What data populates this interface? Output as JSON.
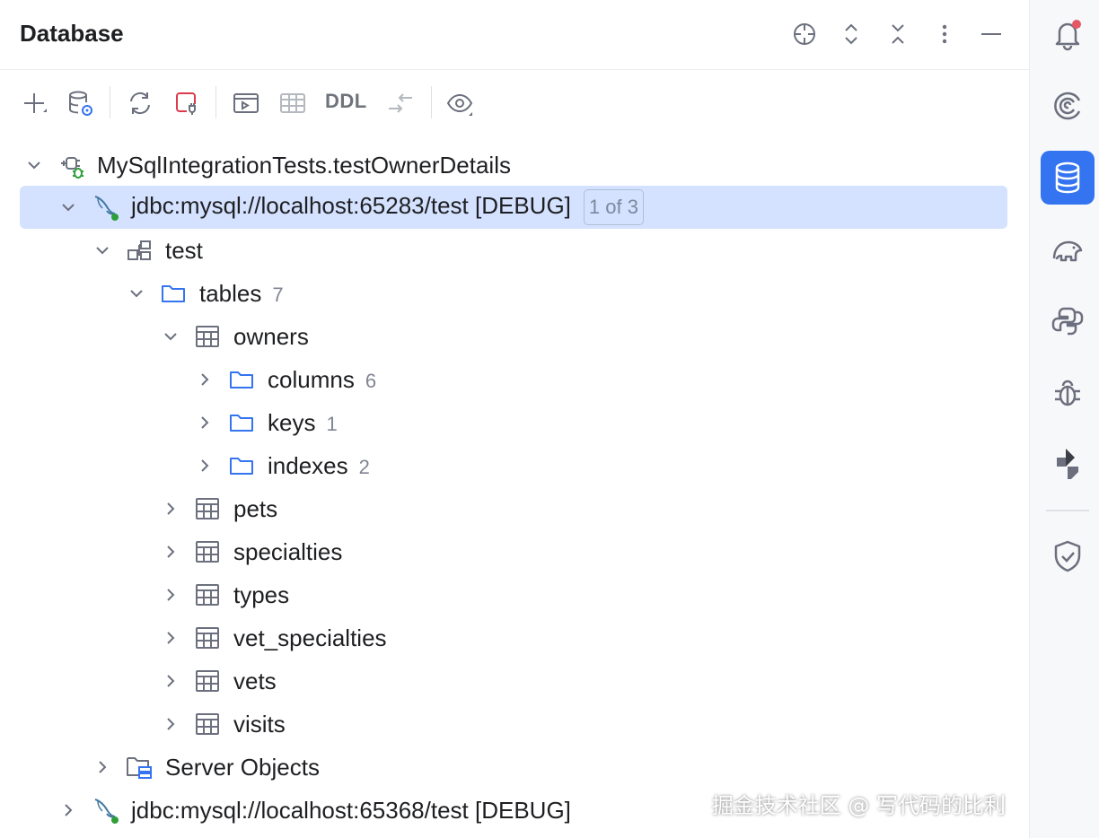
{
  "header": {
    "title": "Database"
  },
  "toolbar": {
    "ddl_label": "DDL"
  },
  "tree": {
    "root": {
      "label": "MySqlIntegrationTests.testOwnerDetails"
    },
    "conn1": {
      "label": "jdbc:mysql://localhost:65283/test [DEBUG]",
      "badge": "1 of 3"
    },
    "schema": {
      "label": "test"
    },
    "tables": {
      "label": "tables",
      "count": "7"
    },
    "owners": {
      "label": "owners"
    },
    "columns": {
      "label": "columns",
      "count": "6"
    },
    "keys": {
      "label": "keys",
      "count": "1"
    },
    "indexes": {
      "label": "indexes",
      "count": "2"
    },
    "pets": {
      "label": "pets"
    },
    "specialties": {
      "label": "specialties"
    },
    "types": {
      "label": "types"
    },
    "vet_specialties": {
      "label": "vet_specialties"
    },
    "vets": {
      "label": "vets"
    },
    "visits": {
      "label": "visits"
    },
    "server_objects": {
      "label": "Server Objects"
    },
    "conn2": {
      "label": "jdbc:mysql://localhost:65368/test [DEBUG]"
    }
  },
  "watermark": "掘金技术社区 @ 写代码的比利",
  "colors": {
    "accent": "#3574f0",
    "selection": "#d4e2ff",
    "folder": "#3574f0",
    "debug_green": "#2e9e3a",
    "notification_dot": "#e55765"
  }
}
